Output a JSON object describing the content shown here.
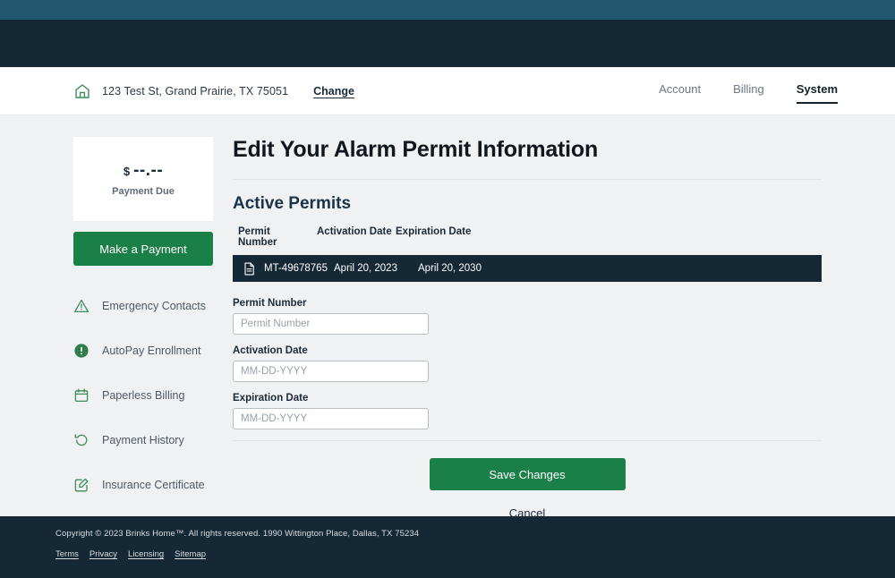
{
  "theme": {
    "teal_bar": "#22586e",
    "navy": "#152836",
    "green": "#1a8048",
    "page_bg": "#f0f1f3"
  },
  "header": {
    "home_icon": "home-icon",
    "address": "123 Test St, Grand Prairie, TX 75051",
    "change_label": "Change",
    "nav": [
      {
        "label": "Account",
        "active": false
      },
      {
        "label": "Billing",
        "active": false
      },
      {
        "label": "System",
        "active": true
      }
    ]
  },
  "sidebar": {
    "payment_card": {
      "currency": "$",
      "amount": "--.--",
      "label": "Payment Due"
    },
    "make_payment_label": "Make a Payment",
    "items": [
      {
        "label": "Emergency Contacts",
        "icon": "warning-triangle-icon"
      },
      {
        "label": "AutoPay Enrollment",
        "icon": "alert-circle-icon"
      },
      {
        "label": "Paperless Billing",
        "icon": "calendar-icon"
      },
      {
        "label": "Payment History",
        "icon": "history-icon"
      },
      {
        "label": "Insurance Certificate",
        "icon": "edit-document-icon"
      }
    ]
  },
  "main": {
    "page_title": "Edit Your Alarm Permit Information",
    "section_title": "Active Permits",
    "table": {
      "columns": [
        "Permit Number",
        "Activation Date",
        "Expiration Date"
      ],
      "rows": [
        {
          "icon": "document-icon",
          "permit_number": "MT-49678765",
          "activation_date": "April 20, 2023",
          "expiration_date": "April 20, 2030"
        }
      ]
    },
    "form": {
      "fields": [
        {
          "label": "Permit Number",
          "placeholder": "Permit Number",
          "value": ""
        },
        {
          "label": "Activation Date",
          "placeholder": "MM-DD-YYYY",
          "value": ""
        },
        {
          "label": "Expiration Date",
          "placeholder": "MM-DD-YYYY",
          "value": ""
        }
      ]
    },
    "save_label": "Save Changes",
    "cancel_label": "Cancel"
  },
  "footer": {
    "copyright": "Copyright © 2023 Brinks Home™. All rights reserved. 1990 Wittington Place, Dallas, TX 75234",
    "links": [
      "Terms",
      "Privacy",
      "Licensing",
      "Sitemap"
    ]
  }
}
